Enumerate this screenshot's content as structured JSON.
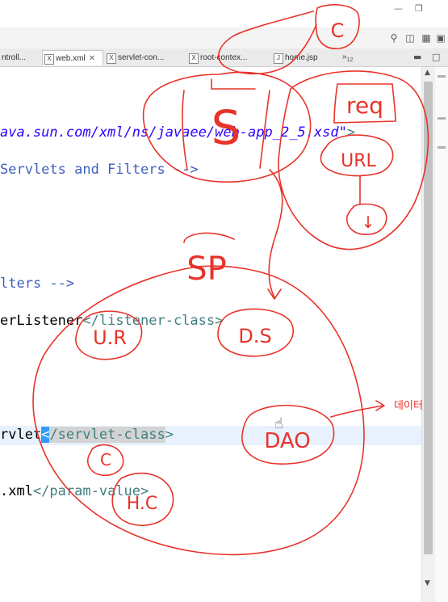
{
  "window": {
    "minimize_glyph": "—",
    "restore_glyph": "❐"
  },
  "tabs": [
    {
      "label": "ntroll...",
      "icon": ""
    },
    {
      "label": "web.xml",
      "icon": "X",
      "close": "✕"
    },
    {
      "label": "servlet-con...",
      "icon": "X"
    },
    {
      "label": "root-contex...",
      "icon": "X"
    },
    {
      "label": "home.jsp",
      "icon": "J"
    }
  ],
  "tab_overflow": {
    "chevron": "»",
    "count": "12"
  },
  "editor": {
    "line1": {
      "url": "ava.sun.com/xml/ns/javaee/web-app_2_5.xsd\"",
      "close": ">"
    },
    "line2": {
      "comment": "Servlets and Filters -->"
    },
    "line3": {
      "comment": "lters -->"
    },
    "line4": {
      "text": "erListener",
      "tag": "</listener-class>"
    },
    "line5": {
      "text": "rvlet",
      "sel": "<",
      "tag": "/servlet-class",
      "close": ">"
    },
    "line6": {
      "text": ".xml",
      "tag": "</param-value>"
    }
  },
  "annotations": {
    "c_top": "C",
    "s": "S",
    "req": "req",
    "url": "URL",
    "arrow_down": "↓",
    "sp": "SP",
    "ur": "U.R",
    "ds": "D.S",
    "dao": "DAO",
    "c_low": "C",
    "hc": "H.C",
    "note": "데이터"
  },
  "colors": {
    "ink": "#e8332a"
  }
}
